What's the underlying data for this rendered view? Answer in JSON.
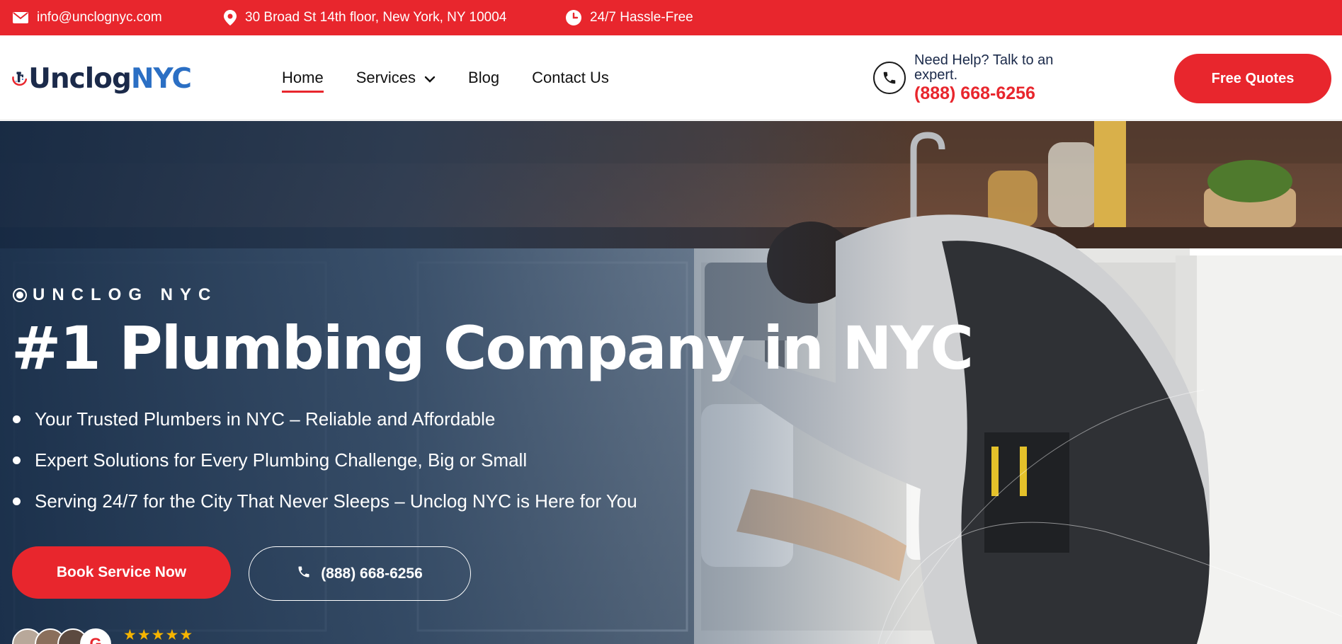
{
  "topbar": {
    "email": "info@unclognyc.com",
    "address": "30 Broad St 14th floor, New York, NY 10004",
    "hours": "24/7 Hassle-Free",
    "background": "#e8262d"
  },
  "header": {
    "logo": {
      "part1": "Unclog",
      "part2": "NYC"
    },
    "nav": [
      {
        "label": "Home",
        "active": true
      },
      {
        "label": "Services",
        "has_dropdown": true
      },
      {
        "label": "Blog"
      },
      {
        "label": "Contact Us"
      }
    ],
    "help": {
      "text": "Need Help? Talk to an expert.",
      "phone": "(888) 668-6256"
    },
    "cta": "Free Quotes"
  },
  "hero": {
    "eyebrow": "UNCLOG NYC",
    "title": "#1 Plumbing Company in NYC",
    "bullets": [
      "Your Trusted Plumbers in NYC – Reliable and Affordable",
      "Expert Solutions for Every Plumbing Challenge, Big or Small",
      "Serving 24/7 for the City That Never Sleeps – Unclog NYC is Here for You"
    ],
    "book_button": "Book Service Now",
    "call_button": "(888) 668-6256",
    "rating_stars": 5
  },
  "colors": {
    "accent": "#e8262d",
    "navy": "#1b2a4a",
    "brand_blue": "#2b6fc4",
    "star": "#f5b400"
  },
  "icons": [
    "mail-icon",
    "map-pin-icon",
    "clock-icon",
    "phone-icon",
    "chevron-down-icon",
    "star-icon"
  ]
}
